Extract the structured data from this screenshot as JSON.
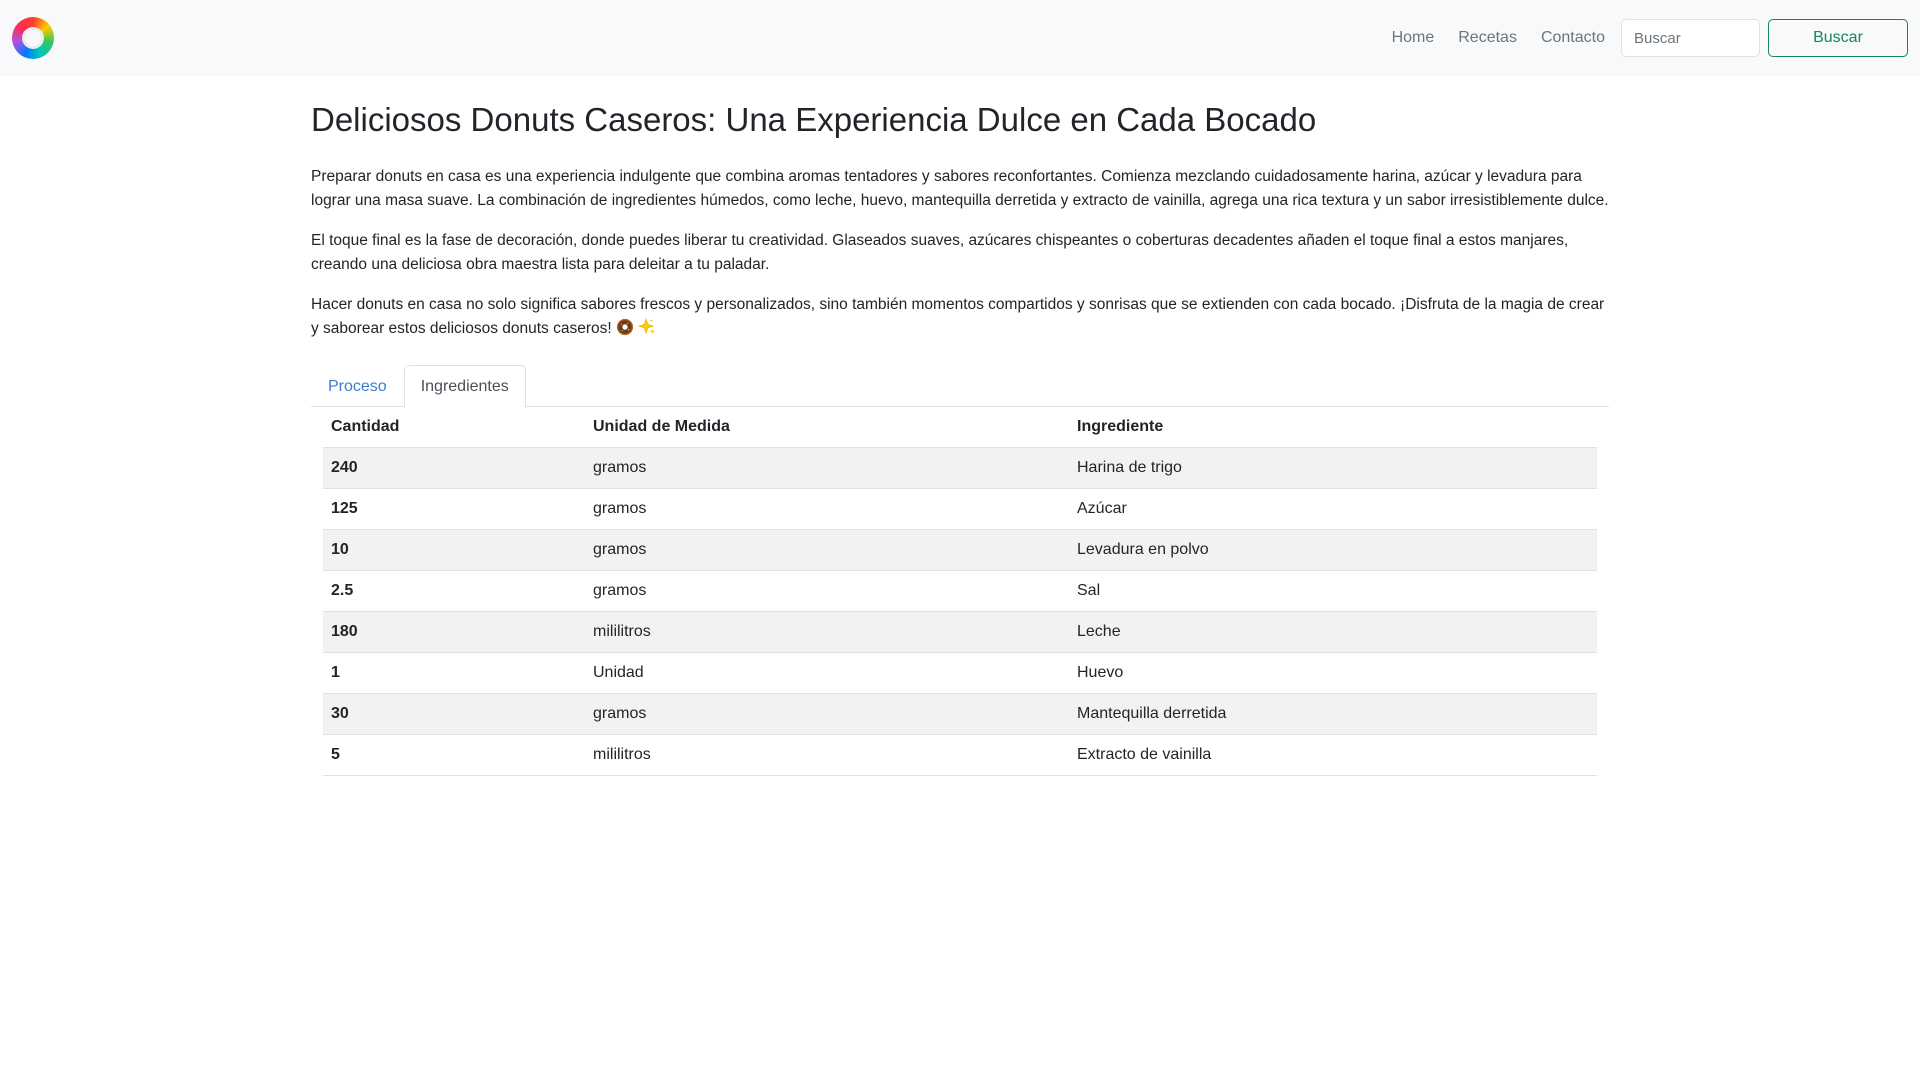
{
  "nav": {
    "links": [
      "Home",
      "Recetas",
      "Contacto"
    ],
    "search_placeholder": "Buscar",
    "search_button": "Buscar"
  },
  "article": {
    "title": "Deliciosos Donuts Caseros: Una Experiencia Dulce en Cada Bocado",
    "paragraphs": [
      "Preparar donuts en casa es una experiencia indulgente que combina aromas tentadores y sabores reconfortantes. Comienza mezclando cuidadosamente harina, azúcar y levadura para lograr una masa suave. La combinación de ingredientes húmedos, como leche, huevo, mantequilla derretida y extracto de vainilla, agrega una rica textura y un sabor irresistiblemente dulce.",
      "El toque final es la fase de decoración, donde puedes liberar tu creatividad. Glaseados suaves, azúcares chispeantes o coberturas decadentes añaden el toque final a estos manjares, creando una deliciosa obra maestra lista para deleitar a tu paladar.",
      "Hacer donuts en casa no solo significa sabores frescos y personalizados, sino también momentos compartidos y sonrisas que se extienden con cada bocado. ¡Disfruta de la magia de crear y saborear estos deliciosos donuts caseros!"
    ],
    "emojis": [
      "donut-icon",
      "sparkles-icon"
    ]
  },
  "tabs": [
    {
      "label": "Proceso",
      "active": false
    },
    {
      "label": "Ingredientes",
      "active": true
    }
  ],
  "table": {
    "headers": [
      "Cantidad",
      "Unidad de Medida",
      "Ingrediente"
    ],
    "rows": [
      [
        "240",
        "gramos",
        "Harina de trigo"
      ],
      [
        "125",
        "gramos",
        "Azúcar"
      ],
      [
        "10",
        "gramos",
        "Levadura en polvo"
      ],
      [
        "2.5",
        "gramos",
        "Sal"
      ],
      [
        "180",
        "mililitros",
        "Leche"
      ],
      [
        "1",
        "Unidad",
        "Huevo"
      ],
      [
        "30",
        "gramos",
        "Mantequilla derretida"
      ],
      [
        "5",
        "mililitros",
        "Extracto de vainilla"
      ]
    ]
  },
  "colors": {
    "navbar_bg": "#f8f9fa",
    "accent_green": "#198754",
    "tab_link": "#3d7ed1",
    "row_stripe": "#f2f2f2"
  }
}
